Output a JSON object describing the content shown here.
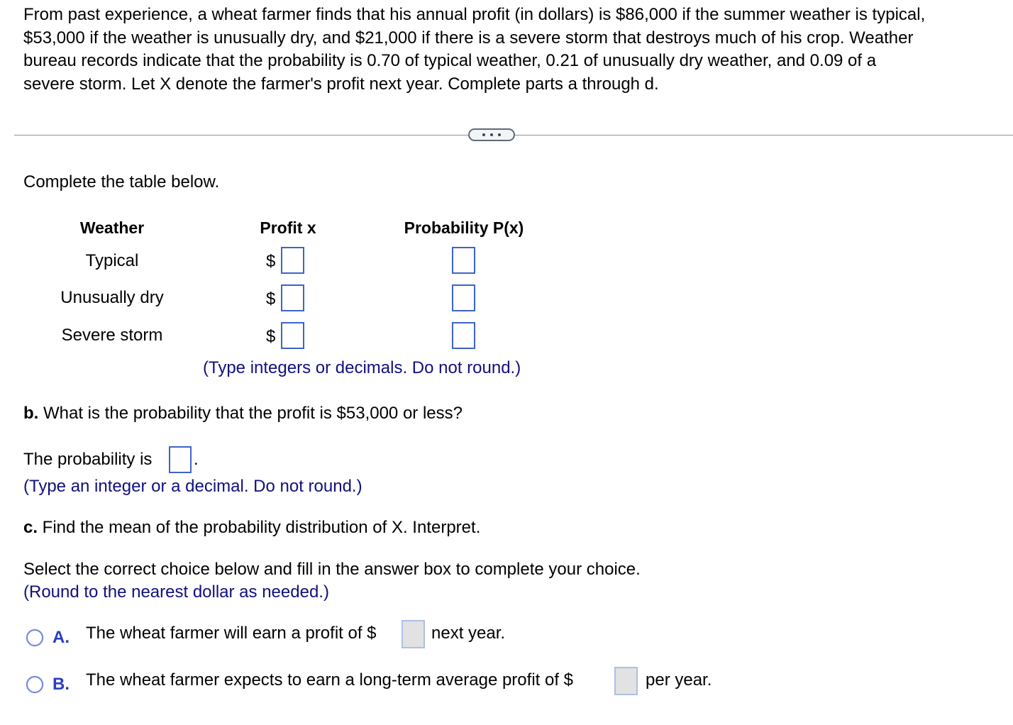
{
  "problem": {
    "lines": [
      "From past experience, a wheat farmer finds that his annual profit (in dollars) is $86,000 if the summer weather is typical,",
      "$53,000 if the weather is unusually dry, and $21,000 if there is a severe storm that destroys much of his crop. Weather",
      "bureau records indicate that the probability is 0.70 of typical weather, 0.21 of unusually dry weather, and 0.09 of a",
      "severe storm. Let X denote the farmer's profit next year. Complete parts a through d."
    ]
  },
  "divider": {
    "more_icon": "ellipsis-icon"
  },
  "part_a": {
    "instruction": "Complete the table below.",
    "table": {
      "headers": [
        "Weather",
        "Profit x",
        "Probability P(x)"
      ],
      "currency_symbol": "$",
      "rows": [
        {
          "weather": "Typical",
          "profit_value": "",
          "probability_value": ""
        },
        {
          "weather": "Unusually dry",
          "profit_value": "",
          "probability_value": ""
        },
        {
          "weather": "Severe storm",
          "profit_value": "",
          "probability_value": ""
        }
      ]
    },
    "hint": "(Type integers or decimals. Do not round.)"
  },
  "part_b": {
    "label": "b.",
    "question": " What is the probability that the profit is $53,000 or less?",
    "answer_prefix": "The probability is",
    "answer_suffix": ".",
    "answer_value": "",
    "hint": "(Type an integer or a decimal. Do not round.)"
  },
  "part_c": {
    "label": "c.",
    "question": " Find the mean of the probability distribution of X. Interpret.",
    "instruction": "Select the correct choice below and fill in the answer box to complete your choice.",
    "hint": "(Round to the nearest dollar as needed.)",
    "choices": [
      {
        "letter": "A.",
        "text_before": "The wheat farmer will earn a profit of $",
        "value": "",
        "text_after": "next year."
      },
      {
        "letter": "B.",
        "text_before": "The wheat farmer expects to earn a long-term average profit of $",
        "value": "",
        "text_after": "per year."
      }
    ]
  }
}
